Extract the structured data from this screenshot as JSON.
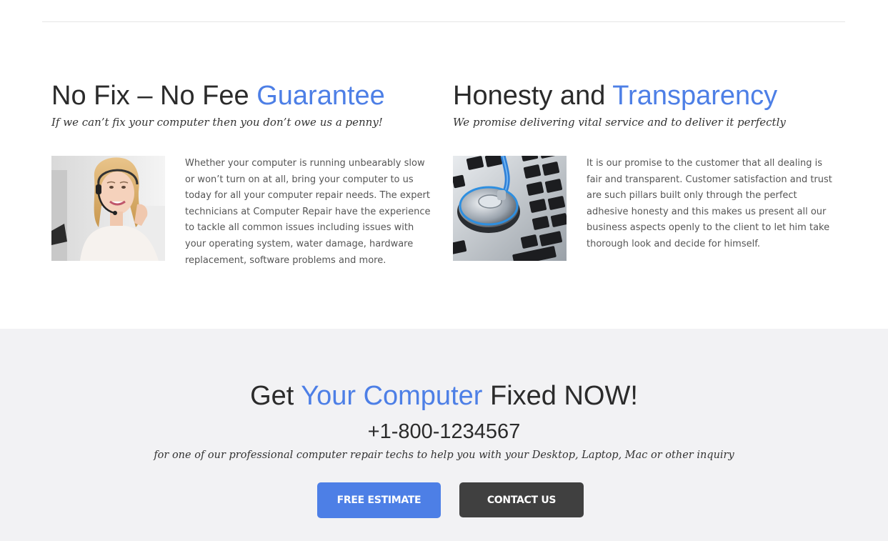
{
  "features": [
    {
      "title_plain": "No Fix – No Fee ",
      "title_accent": "Guarantee",
      "tagline": "If we can’t fix your computer then you don’t owe us a penny!",
      "body": "Whether your computer is running unbearably slow or won’t turn on at all, bring your computer to us today for all your computer repair needs. The expert technicians at Computer Repair have the experience to tackle all common issues including issues with your operating system, water damage, hardware replacement, software problems and more.",
      "image_icon": "support-agent-photo"
    },
    {
      "title_plain": "Honesty and ",
      "title_accent": "Transparency",
      "tagline": "We promise delivering vital service and to deliver it perfectly",
      "body": "It is our promise to the customer that all dealing is fair and transparent. Customer satisfaction and trust are such pillars built only through the perfect adhesive honesty and this makes us present all our business aspects openly to the client to let him take thorough look and decide for himself.",
      "image_icon": "stethoscope-keyboard-photo"
    }
  ],
  "cta": {
    "title_before": "Get ",
    "title_accent": "Your Computer",
    "title_after": " Fixed NOW!",
    "phone": "+1-800-1234567",
    "note": "for one of our professional computer repair techs to help you with your Desktop, Laptop, Mac or other inquiry",
    "estimate_label": "FREE ESTIMATE",
    "contact_label": "CONTACT US"
  },
  "colors": {
    "accent": "#4d7fe6",
    "cta_background": "#f2f2f4",
    "contact_button": "#404040"
  }
}
